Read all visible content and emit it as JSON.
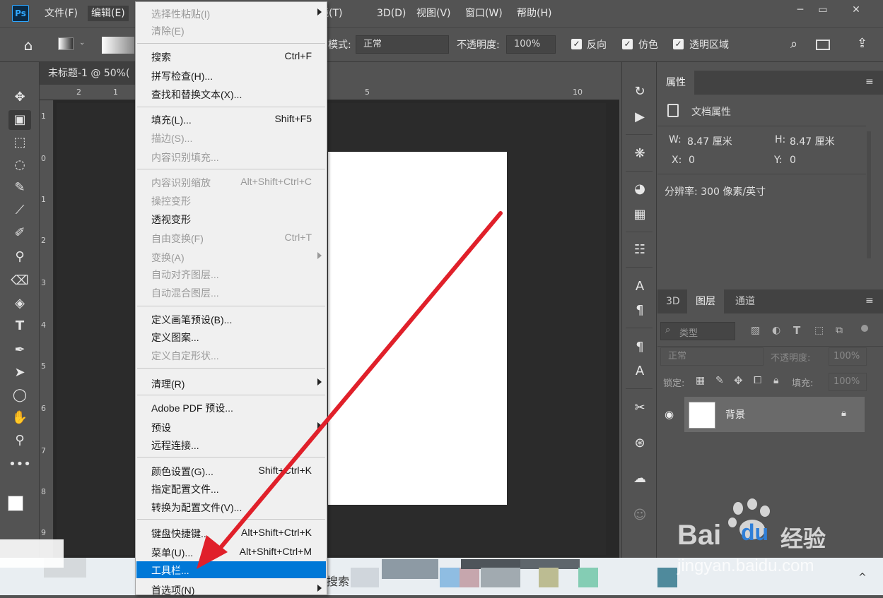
{
  "menubar": {
    "items": [
      "文件(F)",
      "编辑(E)",
      "滤镜(T)",
      "3D(D)",
      "视图(V)",
      "窗口(W)",
      "帮助(H)"
    ],
    "logo": "Ps",
    "window_buttons": [
      "─",
      "▭",
      "✕"
    ]
  },
  "options": {
    "mode_label": "模式:",
    "mode_value": "正常",
    "opacity_label": "不透明度:",
    "opacity_value": "100%",
    "reverse_label": "反向",
    "dither_label": "仿色",
    "transparency_label": "透明区域"
  },
  "document": {
    "tab_title": "未标题-1 @ 50%(",
    "ruler_top": [
      "2",
      "1",
      "5",
      "10"
    ],
    "ruler_left": [
      "1",
      "0",
      "1",
      "2",
      "3",
      "4",
      "5",
      "6",
      "7",
      "8",
      "9"
    ]
  },
  "properties": {
    "tab": "属性",
    "doc_props": "文档属性",
    "w_label": "W:",
    "w_value": "8.47 厘米",
    "h_label": "H:",
    "h_value": "8.47 厘米",
    "x_label": "X:",
    "x_value": "0",
    "y_label": "Y:",
    "y_value": "0",
    "resolution": "分辨率: 300 像素/英寸"
  },
  "layers": {
    "tabs": [
      "3D",
      "图层",
      "通道"
    ],
    "filter_placeholder": "类型",
    "blend_mode": "正常",
    "opacity_label": "不透明度:",
    "opacity_value": "100%",
    "lock_label": "锁定:",
    "fill_label": "填充:",
    "fill_value": "100%",
    "layer_name": "背景"
  },
  "edit_menu": {
    "items": [
      {
        "label": "选择性粘贴(I)",
        "shortcut": "",
        "disabled": true,
        "submenu": true
      },
      {
        "label": "清除(E)",
        "shortcut": "",
        "disabled": true
      },
      {
        "label": "搜索",
        "shortcut": "Ctrl+F"
      },
      {
        "label": "拼写检查(H)...",
        "shortcut": ""
      },
      {
        "label": "查找和替换文本(X)...",
        "shortcut": ""
      },
      {
        "label": "填充(L)...",
        "shortcut": "Shift+F5"
      },
      {
        "label": "描边(S)...",
        "shortcut": "",
        "disabled": true
      },
      {
        "label": "内容识别填充...",
        "shortcut": "",
        "disabled": true
      },
      {
        "label": "内容识别缩放",
        "shortcut": "Alt+Shift+Ctrl+C",
        "disabled": true
      },
      {
        "label": "操控变形",
        "shortcut": "",
        "disabled": true
      },
      {
        "label": "透视变形",
        "shortcut": ""
      },
      {
        "label": "自由变换(F)",
        "shortcut": "Ctrl+T",
        "disabled": true
      },
      {
        "label": "变换(A)",
        "shortcut": "",
        "disabled": true,
        "submenu": true
      },
      {
        "label": "自动对齐图层...",
        "shortcut": "",
        "disabled": true
      },
      {
        "label": "自动混合图层...",
        "shortcut": "",
        "disabled": true
      },
      {
        "label": "定义画笔预设(B)...",
        "shortcut": ""
      },
      {
        "label": "定义图案...",
        "shortcut": ""
      },
      {
        "label": "定义自定形状...",
        "shortcut": "",
        "disabled": true
      },
      {
        "label": "清理(R)",
        "shortcut": "",
        "submenu": true
      },
      {
        "label": "Adobe PDF 预设...",
        "shortcut": ""
      },
      {
        "label": "预设",
        "shortcut": "",
        "submenu": true
      },
      {
        "label": "远程连接...",
        "shortcut": ""
      },
      {
        "label": "颜色设置(G)...",
        "shortcut": "Shift+Ctrl+K"
      },
      {
        "label": "指定配置文件...",
        "shortcut": ""
      },
      {
        "label": "转换为配置文件(V)...",
        "shortcut": ""
      },
      {
        "label": "键盘快捷键...",
        "shortcut": "Alt+Shift+Ctrl+K"
      },
      {
        "label": "菜单(U)...",
        "shortcut": "Alt+Shift+Ctrl+M"
      },
      {
        "label": "工具栏...",
        "shortcut": "",
        "highlighted": true
      },
      {
        "label": "首选项(N)",
        "shortcut": "",
        "submenu": true
      }
    ]
  },
  "taskbar": {
    "search_text": "搜索"
  },
  "watermark": {
    "brand": "Bai",
    "brand2": "du",
    "cn": "经验",
    "url": "jingyan.baidu.com"
  },
  "colors": {
    "accent": "#0078d7",
    "arrow": "#e0202a"
  }
}
